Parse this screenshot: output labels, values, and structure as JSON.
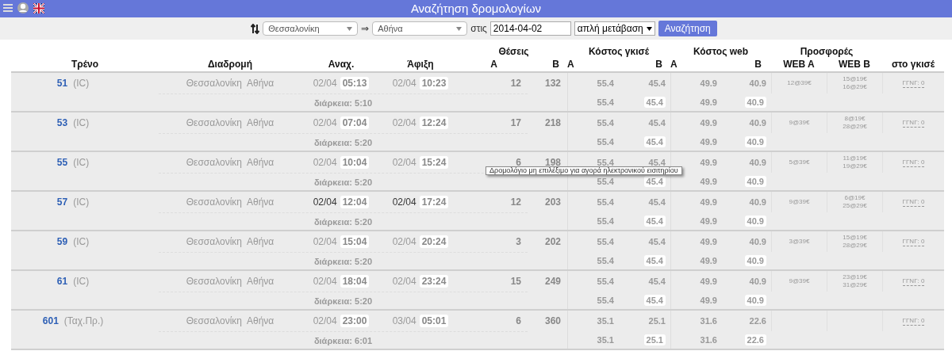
{
  "header": {
    "title": "Αναζήτηση δρομολογίων"
  },
  "search": {
    "from": "Θεσσαλονίκη",
    "arrow": "⇒",
    "to": "Αθήνα",
    "date_label": "στις",
    "date": "2014-04-02",
    "trip_type": "απλή μετάβαση",
    "button": "Αναζήτηση"
  },
  "columns": {
    "train": "Τρένο",
    "route": "Διαδρομή",
    "departure": "Αναχ.",
    "arrival": "Άφιξη",
    "seats": "Θέσεις",
    "seats_a": "A",
    "seats_b": "B",
    "counter_cost": "Κόστος γκισέ",
    "counter_a": "A",
    "counter_b": "B",
    "web_cost": "Κόστος web",
    "web_a": "A",
    "web_b": "B",
    "offers": "Προσφορές",
    "offers_web_a": "WEB A",
    "offers_web_b": "WEB B",
    "offers_counter": "στο γκισέ"
  },
  "rows": [
    {
      "train": "51",
      "type": "(IC)",
      "from": "Θεσσαλονίκη",
      "to": "Αθήνα",
      "dep_date": "02/04",
      "dep_time": "05:13",
      "arr_date": "02/04",
      "arr_time": "10:23",
      "highlighted": false,
      "seats_a": "12",
      "seats_b": "132",
      "fares": [
        "55.4",
        "45.4",
        "49.9",
        "40.9"
      ],
      "fares_line_2": [
        "55.4",
        "45.4",
        "49.9",
        "40.9"
      ],
      "offer_web_a": "12@39€",
      "offer_web_b": [
        "15@19€",
        "16@29€"
      ],
      "offer_counter": "ΓΓΝΓ: 0",
      "duration": "διάρκεια: 5:10"
    },
    {
      "train": "53",
      "type": "(IC)",
      "from": "Θεσσαλονίκη",
      "to": "Αθήνα",
      "dep_date": "02/04",
      "dep_time": "07:04",
      "arr_date": "02/04",
      "arr_time": "12:24",
      "highlighted": false,
      "seats_a": "17",
      "seats_b": "218",
      "fares": [
        "55.4",
        "45.4",
        "49.9",
        "40.9"
      ],
      "fares_line_2": [
        "55.4",
        "45.4",
        "49.9",
        "40.9"
      ],
      "offer_web_a": "9@39€",
      "offer_web_b": [
        "8@19€",
        "28@29€"
      ],
      "offer_counter": "ΓΓΝΓ: 0",
      "duration": "διάρκεια: 5:20"
    },
    {
      "train": "55",
      "type": "(IC)",
      "from": "Θεσσαλονίκη",
      "to": "Αθήνα",
      "dep_date": "02/04",
      "dep_time": "10:04",
      "arr_date": "02/04",
      "arr_time": "15:24",
      "highlighted": false,
      "seats_a": "6",
      "seats_b": "198",
      "fares": [
        "55.4",
        "45.4",
        "49.9",
        "40.9"
      ],
      "fares_line_2": [
        "55.4",
        "45.4",
        "49.9",
        "40.9"
      ],
      "offer_web_a": "5@39€",
      "offer_web_b": [
        "11@19€",
        "19@29€"
      ],
      "offer_counter": "ΓΓΝΓ: 0",
      "duration": "διάρκεια: 5:20"
    },
    {
      "train": "57",
      "type": "(IC)",
      "from": "Θεσσαλονίκη",
      "to": "Αθήνα",
      "dep_date": "02/04",
      "dep_time": "12:04",
      "arr_date": "02/04",
      "arr_time": "17:24",
      "highlighted": true,
      "seats_a": "12",
      "seats_b": "203",
      "fares": [
        "55.4",
        "45.4",
        "49.9",
        "40.9"
      ],
      "fares_line_2": [
        "55.4",
        "45.4",
        "49.9",
        "40.9"
      ],
      "offer_web_a": "9@39€",
      "offer_web_b": [
        "6@19€",
        "25@29€"
      ],
      "offer_counter": "ΓΓΝΓ: 0",
      "duration": "διάρκεια: 5:20"
    },
    {
      "train": "59",
      "type": "(IC)",
      "from": "Θεσσαλονίκη",
      "to": "Αθήνα",
      "dep_date": "02/04",
      "dep_time": "15:04",
      "arr_date": "02/04",
      "arr_time": "20:24",
      "highlighted": false,
      "seats_a": "3",
      "seats_b": "202",
      "fares": [
        "55.4",
        "45.4",
        "49.9",
        "40.9"
      ],
      "fares_line_2": [
        "55.4",
        "45.4",
        "49.9",
        "40.9"
      ],
      "offer_web_a": "3@39€",
      "offer_web_b": [
        "15@19€",
        "28@29€"
      ],
      "offer_counter": "ΓΓΝΓ: 0",
      "duration": "διάρκεια: 5:20"
    },
    {
      "train": "61",
      "type": "(IC)",
      "from": "Θεσσαλονίκη",
      "to": "Αθήνα",
      "dep_date": "02/04",
      "dep_time": "18:04",
      "arr_date": "02/04",
      "arr_time": "23:24",
      "highlighted": false,
      "seats_a": "15",
      "seats_b": "249",
      "fares": [
        "55.4",
        "45.4",
        "49.9",
        "40.9"
      ],
      "fares_line_2": [
        "55.4",
        "45.4",
        "49.9",
        "40.9"
      ],
      "offer_web_a": "9@39€",
      "offer_web_b": [
        "23@19€",
        "31@29€"
      ],
      "offer_counter": "ΓΓΝΓ: 0",
      "duration": "διάρκεια: 5:20"
    },
    {
      "train": "601",
      "type": "(Ταχ.Πρ.)",
      "from": "Θεσσαλονίκη",
      "to": "Αθήνα",
      "dep_date": "02/04",
      "dep_time": "23:00",
      "arr_date": "03/04",
      "arr_time": "05:01",
      "highlighted": false,
      "seats_a": "6",
      "seats_b": "360",
      "fares": [
        "35.1",
        "25.1",
        "31.6",
        "22.6"
      ],
      "fares_line_2": [
        "35.1",
        "25.1",
        "31.6",
        "22.6"
      ],
      "offer_counter": "ΓΓΝΓ: 0",
      "duration": "διάρκεια: 6:01"
    }
  ],
  "tooltip": {
    "text": "Δρομολόγιο μη επιλέξιμο για αγορά ηλεκτρονικού εισιτηρίου"
  }
}
